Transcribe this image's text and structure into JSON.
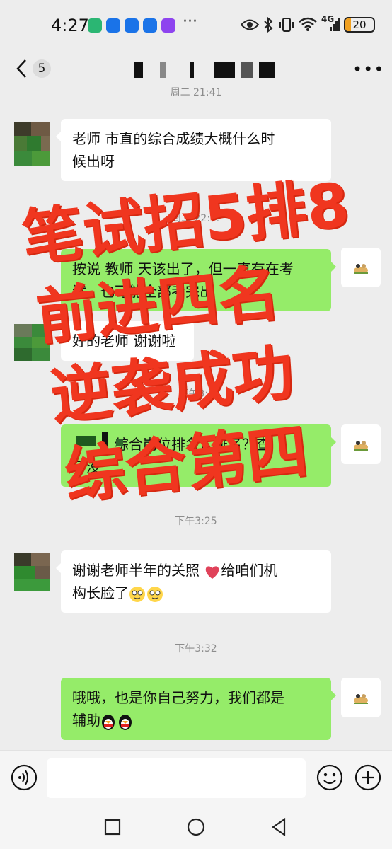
{
  "status_bar": {
    "time": "4:27",
    "more": "···",
    "network": "4G",
    "battery_text": "20",
    "battery_level": 0.2,
    "app_icon_colors": [
      "#2bb673",
      "#1a73e8",
      "#1a73e8",
      "#1a73e8",
      "#8e44ef"
    ]
  },
  "nav": {
    "unread_count": "5",
    "more": "•••"
  },
  "messages": [
    {
      "kind": "time",
      "text": "周二 21:41"
    },
    {
      "kind": "left",
      "lines": [
        "老师 市直的综合成绩大概什么时",
        "候出呀"
      ]
    },
    {
      "kind": "time",
      "text": "周二 22:??"
    },
    {
      "kind": "right",
      "lines": [
        "按说 教师 天该出了，但一直有在考",
        "试，也可能全部考完出"
      ]
    },
    {
      "kind": "left",
      "lines": [
        "好的老师 谢谢啦"
      ]
    },
    {
      "kind": "time",
      "text": "下午3:?"
    },
    {
      "kind": "right",
      "lines": [
        "综合岗位排名，排名？查",
        "了没"
      ]
    },
    {
      "kind": "time",
      "text": "下午3:25"
    },
    {
      "kind": "left",
      "lines": [
        "谢谢老师半年的关照 ",
        "构长脸了"
      ],
      "inline": "给咱们机"
    },
    {
      "kind": "time",
      "text": "下午3:32"
    },
    {
      "kind": "right",
      "lines": [
        "哦哦，也是你自己努力，我们都是",
        "辅助"
      ]
    }
  ],
  "overlay": {
    "lines": [
      "笔试招5排8",
      "前进四名",
      "逆袭成功",
      "综合第四"
    ],
    "color": "#f0361f"
  },
  "colors": {
    "background": "#ededed",
    "bubble_self": "#95ec69",
    "bubble_other": "#ffffff"
  },
  "icons": [
    "back-icon",
    "more-icon",
    "voice-icon",
    "emoji-icon",
    "plus-icon",
    "heart-icon",
    "penguin-icon",
    "square-icon",
    "circle-icon",
    "triangle-icon"
  ]
}
